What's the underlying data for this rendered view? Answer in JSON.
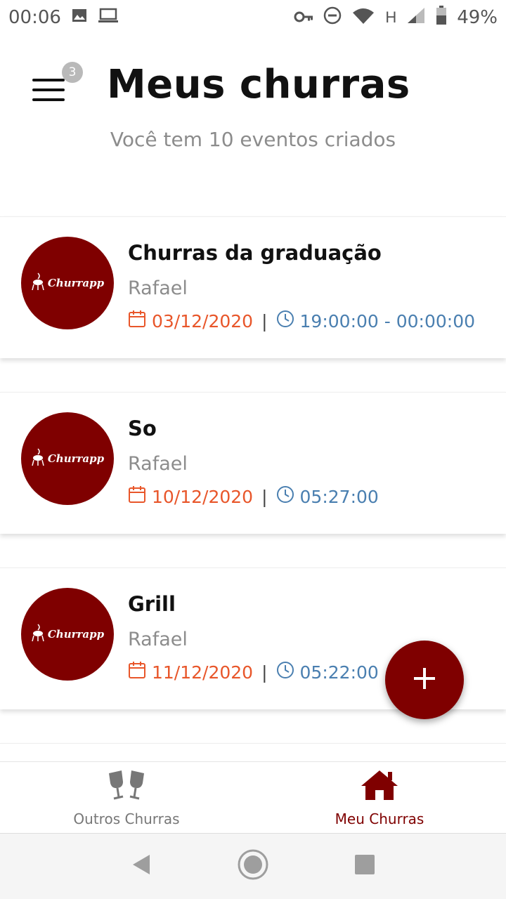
{
  "status_bar": {
    "time": "00:06",
    "network": "H",
    "battery": "49%"
  },
  "header": {
    "title": "Meus churras",
    "subtitle": "Você tem 10 eventos criados",
    "menu_badge": "3"
  },
  "events": [
    {
      "title": "Churras da graduação",
      "owner": "Rafael",
      "date": "03/12/2020",
      "time": "19:00:00 - 00:00:00",
      "logo": "Churrapp"
    },
    {
      "title": "So",
      "owner": "Rafael",
      "date": "10/12/2020",
      "time": "05:27:00",
      "logo": "Churrapp"
    },
    {
      "title": "Grill",
      "owner": "Rafael",
      "date": "11/12/2020",
      "time": "05:22:00",
      "logo": "Churrapp"
    }
  ],
  "separator": "|",
  "fab": {
    "icon": "plus-icon"
  },
  "bottom_nav": {
    "items": [
      {
        "label": "Outros Churras",
        "icon": "toast-glasses-icon",
        "active": false
      },
      {
        "label": "Meu Churras",
        "icon": "home-icon",
        "active": true
      }
    ]
  },
  "colors": {
    "brand": "#7f0000",
    "date": "#e8562a",
    "time": "#4a7fb0",
    "muted": "#8c8c8c"
  }
}
